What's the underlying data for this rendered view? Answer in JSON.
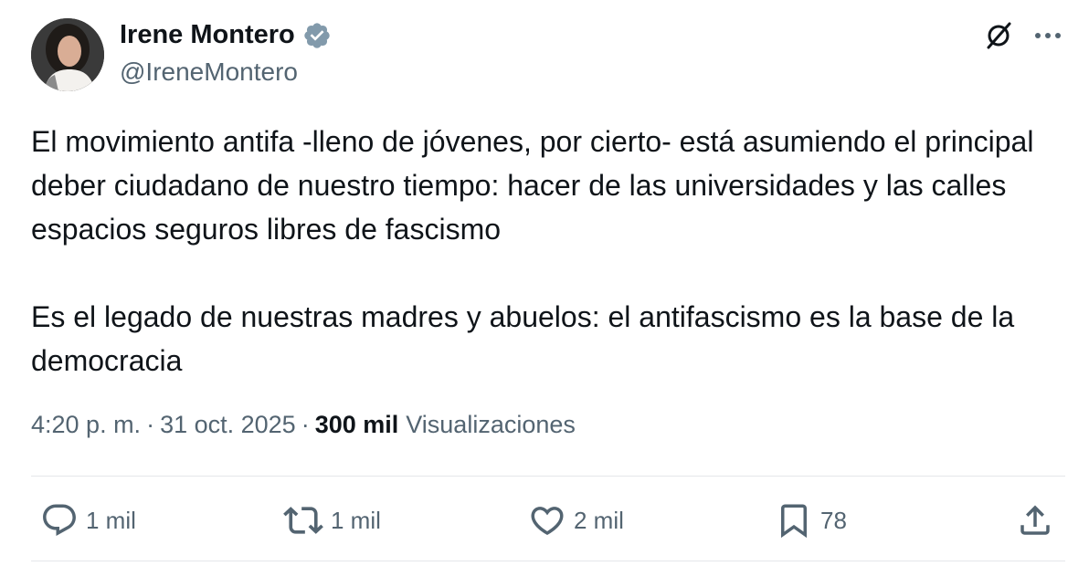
{
  "author": {
    "display_name": "Irene Montero",
    "handle": "@IreneMontero",
    "verified_icon": "verified-badge-icon"
  },
  "header_actions": {
    "grok_icon": "grok-icon",
    "more_icon": "more-icon"
  },
  "tweet": {
    "paragraphs": [
      "El movimiento antifa -lleno de jóvenes, por cierto- está asumiendo el principal deber ciudadano de nuestro tiempo: hacer de las universidades y las calles espacios seguros libres de fascismo",
      "Es el legado de nuestras madres y abuelos: el antifascismo es la base de la democracia"
    ]
  },
  "meta": {
    "time": "4:20 p. m.",
    "separator": "·",
    "date": "31 oct. 2025",
    "views_count": "300 mil",
    "views_label": "Visualizaciones"
  },
  "actions": {
    "reply": {
      "count": "1 mil",
      "icon": "reply-icon"
    },
    "repost": {
      "count": "1 mil",
      "icon": "repost-icon"
    },
    "like": {
      "count": "2 mil",
      "icon": "like-icon"
    },
    "bookmark": {
      "count": "78",
      "icon": "bookmark-icon"
    },
    "share": {
      "icon": "share-icon"
    }
  },
  "colors": {
    "text_primary": "#0f1419",
    "text_secondary": "#536471",
    "verified_badge": "#829aab",
    "divider": "#e5e7ea"
  }
}
